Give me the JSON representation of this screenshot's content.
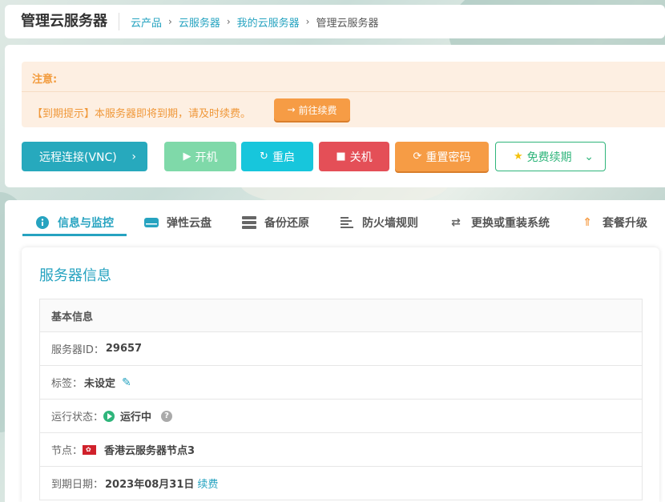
{
  "header": {
    "title": "管理云服务器",
    "breadcrumbs": [
      "云产品",
      "云服务器",
      "我的云服务器",
      "管理云服务器"
    ]
  },
  "notice": {
    "title": "注意:",
    "message": "【到期提示】本服务器即将到期，请及时续费。",
    "renew_button": "前往续费"
  },
  "actions": {
    "vnc": "远程连接(VNC)",
    "power_on": "开机",
    "restart": "重启",
    "power_off": "关机",
    "reset_password": "重置密码",
    "free_renew": "免费续期"
  },
  "tabs": [
    {
      "label": "信息与监控",
      "icon": "info-icon",
      "active": true
    },
    {
      "label": "弹性云盘",
      "icon": "disk-icon"
    },
    {
      "label": "备份还原",
      "icon": "server-icon"
    },
    {
      "label": "防火墙规则",
      "icon": "list-icon"
    },
    {
      "label": "更换或重装系统",
      "icon": "swap-icon"
    },
    {
      "label": "套餐升级",
      "icon": "upgrade-icon"
    }
  ],
  "server_info": {
    "section_title": "服务器信息",
    "table_header": "基本信息",
    "id_label": "服务器ID：",
    "id_value": "29657",
    "tag_label": "标签：",
    "tag_value": "未设定",
    "status_label": "运行状态：",
    "status_value": "运行中",
    "node_label": "节点：",
    "node_value": "香港云服务器节点3",
    "expire_label": "到期日期：",
    "expire_value": "2023年08月31日",
    "renew_link": "续费"
  },
  "colors": {
    "accent": "#26a3c0",
    "green": "#2fb57b",
    "orange": "#f69c45",
    "red": "#e44f57"
  }
}
